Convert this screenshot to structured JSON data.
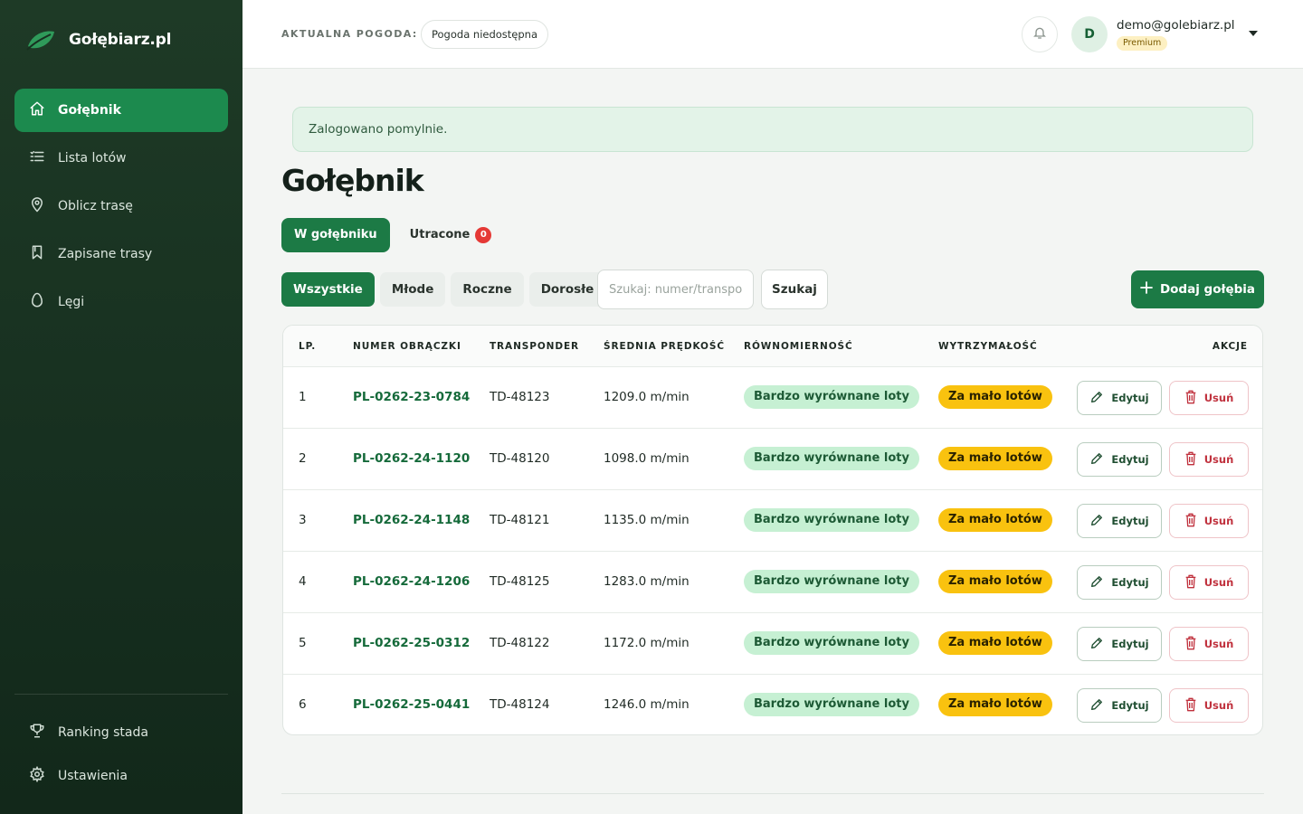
{
  "brand": {
    "name": "Gołębiarz.pl"
  },
  "sidebar": {
    "items": [
      {
        "label": "Gołębnik",
        "icon": "home-icon",
        "active": true
      },
      {
        "label": "Lista lotów",
        "icon": "list-icon"
      },
      {
        "label": "Oblicz trasę",
        "icon": "map-pin-icon"
      },
      {
        "label": "Zapisane trasy",
        "icon": "bookmark-icon"
      },
      {
        "label": "Lęgi",
        "icon": "egg-icon"
      }
    ],
    "bottom_items": [
      {
        "label": "Ranking stada",
        "icon": "trophy-icon"
      },
      {
        "label": "Ustawienia",
        "icon": "gear-icon"
      }
    ]
  },
  "topbar": {
    "weather_label": "AKTUALNA POGODA:",
    "weather_value": "Pogoda niedostępna",
    "avatar_initial": "D",
    "email": "demo@golebiarz.pl",
    "plan": "Premium"
  },
  "alert": {
    "message": "Zalogowano pomylnie."
  },
  "page": {
    "title": "Gołębnik"
  },
  "tabs": [
    {
      "label": "W gołębniku",
      "active": true
    },
    {
      "label": "Utracone",
      "count": "0"
    }
  ],
  "filters": [
    {
      "label": "Wszystkie",
      "active": true
    },
    {
      "label": "Młode"
    },
    {
      "label": "Roczne"
    },
    {
      "label": "Dorosłe"
    }
  ],
  "search": {
    "placeholder": "Szukaj: numer/transponder",
    "value": "",
    "button": "Szukaj"
  },
  "add_button": {
    "label": "Dodaj gołębia"
  },
  "table": {
    "headers": [
      "LP.",
      "NUMER OBRĄCZKI",
      "TRANSPONDER",
      "ŚREDNIA PRĘDKOŚĆ",
      "RÓWNOMIERNOŚĆ",
      "WYTRZYMAŁOŚĆ",
      "AKCJE"
    ],
    "edit_label": "Edytuj",
    "delete_label": "Usuń",
    "rows": [
      {
        "lp": "1",
        "ring": "PL-0262-23-0784",
        "transponder": "TD-48123",
        "speed": "1209.0 m/min",
        "evenness": "Bardzo wyrównane loty",
        "endurance": "Za mało lotów"
      },
      {
        "lp": "2",
        "ring": "PL-0262-24-1120",
        "transponder": "TD-48120",
        "speed": "1098.0 m/min",
        "evenness": "Bardzo wyrównane loty",
        "endurance": "Za mało lotów"
      },
      {
        "lp": "3",
        "ring": "PL-0262-24-1148",
        "transponder": "TD-48121",
        "speed": "1135.0 m/min",
        "evenness": "Bardzo wyrównane loty",
        "endurance": "Za mało lotów"
      },
      {
        "lp": "4",
        "ring": "PL-0262-24-1206",
        "transponder": "TD-48125",
        "speed": "1283.0 m/min",
        "evenness": "Bardzo wyrównane loty",
        "endurance": "Za mało lotów"
      },
      {
        "lp": "5",
        "ring": "PL-0262-25-0312",
        "transponder": "TD-48122",
        "speed": "1172.0 m/min",
        "evenness": "Bardzo wyrównane loty",
        "endurance": "Za mało lotów"
      },
      {
        "lp": "6",
        "ring": "PL-0262-25-0441",
        "transponder": "TD-48124",
        "speed": "1246.0 m/min",
        "evenness": "Bardzo wyrównane loty",
        "endurance": "Za mało lotów"
      }
    ]
  },
  "colors": {
    "brand_green": "#1c7a45",
    "sidebar_bg": "#1e3a26",
    "badge_green": "#c6f0d3",
    "badge_yellow": "#f9c20f",
    "danger": "#c0313d"
  }
}
